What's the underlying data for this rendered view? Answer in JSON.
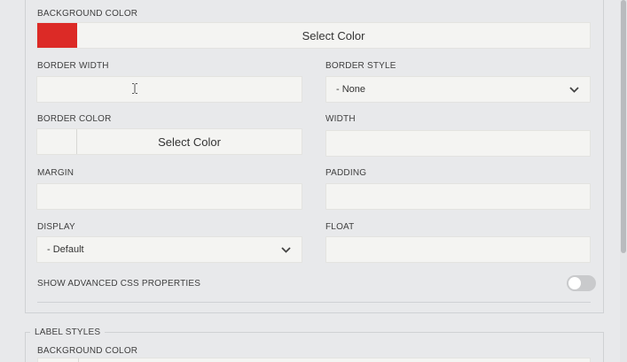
{
  "form": {
    "background_color": {
      "label": "BACKGROUND COLOR",
      "button_label": "Select Color",
      "swatch_color": "#dc2a26"
    },
    "border_width": {
      "label": "BORDER WIDTH",
      "value": ""
    },
    "border_style": {
      "label": "BORDER STYLE",
      "value": "- None"
    },
    "border_color": {
      "label": "BORDER COLOR",
      "button_label": "Select Color"
    },
    "width": {
      "label": "WIDTH",
      "value": ""
    },
    "margin": {
      "label": "MARGIN",
      "value": ""
    },
    "padding": {
      "label": "PADDING",
      "value": ""
    },
    "display": {
      "label": "DISPLAY",
      "value": "- Default"
    },
    "float": {
      "label": "FLOAT",
      "value": ""
    },
    "advanced_css": {
      "label": "SHOW ADVANCED CSS PROPERTIES",
      "enabled": false
    }
  },
  "label_styles": {
    "legend": "LABEL STYLES",
    "background_color": {
      "label": "BACKGROUND COLOR"
    }
  },
  "icons": {
    "chevron": "chevron-down-icon",
    "cursor": "text-cursor-icon"
  }
}
